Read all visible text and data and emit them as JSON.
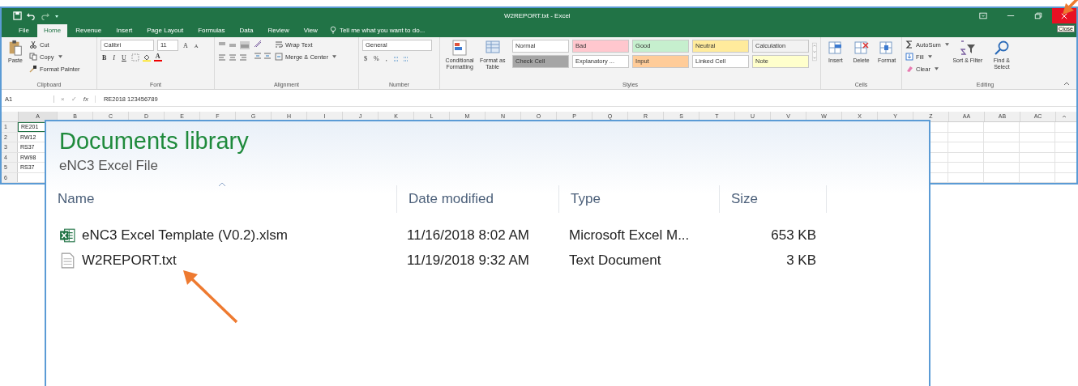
{
  "window": {
    "title": "W2REPORT.txt - Excel",
    "tooltip": "Close"
  },
  "tabs": [
    {
      "label": "File",
      "selected": false
    },
    {
      "label": "Home",
      "selected": true
    },
    {
      "label": "Revenue",
      "selected": false
    },
    {
      "label": "Insert",
      "selected": false
    },
    {
      "label": "Page Layout",
      "selected": false
    },
    {
      "label": "Formulas",
      "selected": false
    },
    {
      "label": "Data",
      "selected": false
    },
    {
      "label": "Review",
      "selected": false
    },
    {
      "label": "View",
      "selected": false
    }
  ],
  "tell_me": "Tell me what you want to do...",
  "ribbon": {
    "clipboard": {
      "label": "Clipboard",
      "paste": "Paste",
      "cut": "Cut",
      "copy": "Copy",
      "format_painter": "Format Painter"
    },
    "font": {
      "label": "Font",
      "font_name": "Calibri",
      "font_size": "11",
      "grow": "A",
      "shrink": "A",
      "bold": "B",
      "italic": "I",
      "underline": "U",
      "font_color": "A"
    },
    "alignment": {
      "label": "Alignment",
      "wrap_text": "Wrap Text",
      "merge": "Merge & Center"
    },
    "number": {
      "label": "Number",
      "format": "General",
      "currency": "$",
      "percent": "%",
      "comma": ","
    },
    "styles": {
      "label": "Styles",
      "conditional": "Conditional Formatting",
      "format_table": "Format as Table",
      "cells": [
        {
          "label": "Normal",
          "color": "#ffffff"
        },
        {
          "label": "Bad",
          "color": "#ffc7ce"
        },
        {
          "label": "Good",
          "color": "#c6efce"
        },
        {
          "label": "Neutral",
          "color": "#ffeb9c"
        },
        {
          "label": "Calculation",
          "color": "#f2f2f2"
        },
        {
          "label": "Check Cell",
          "color": "#a5a5a5"
        },
        {
          "label": "Explanatory ...",
          "color": "#ffffff"
        },
        {
          "label": "Input",
          "color": "#ffcc99"
        },
        {
          "label": "Linked Cell",
          "color": "#ffffff"
        },
        {
          "label": "Note",
          "color": "#ffffcc"
        }
      ]
    },
    "cells": {
      "label": "Cells",
      "buttons": [
        "Insert",
        "Delete",
        "Format"
      ]
    },
    "editing": {
      "label": "Editing",
      "autosum": "AutoSum",
      "fill": "Fill",
      "clear": "Clear",
      "sort": "Sort & Filter",
      "find": "Find & Select"
    }
  },
  "formula_bar": {
    "name_box": "A1",
    "cancel": "×",
    "enter": "✓",
    "fx": "fx",
    "formula": "RE2018 123456789"
  },
  "sheet": {
    "columns": [
      "A",
      "B",
      "C",
      "D",
      "E",
      "F",
      "G",
      "H",
      "I",
      "J",
      "K",
      "L",
      "M",
      "N",
      "O",
      "P",
      "Q",
      "R",
      "S",
      "T",
      "U",
      "V",
      "W",
      "X",
      "Y",
      "Z",
      "AA",
      "AB",
      "AC"
    ],
    "rows": [
      {
        "number": "1",
        "a": "RE201"
      },
      {
        "number": "2",
        "a": "RW12"
      },
      {
        "number": "3",
        "a": "RS37"
      },
      {
        "number": "4",
        "a": "RW98"
      },
      {
        "number": "5",
        "a": "RS37"
      },
      {
        "number": "6"
      }
    ]
  },
  "explorer": {
    "title": "Documents library",
    "subtitle": "eNC3 Excel File",
    "columns": [
      "Name",
      "Date modified",
      "Type",
      "Size"
    ],
    "files": [
      {
        "kind": "excel",
        "name": "eNC3 Excel Template (V0.2).xlsm",
        "date": "11/16/2018 8:02 AM",
        "type": "Microsoft Excel M...",
        "size": "653 KB"
      },
      {
        "kind": "text",
        "name": "W2REPORT.txt",
        "date": "11/19/2018 9:32 AM",
        "type": "Text Document",
        "size": "3 KB"
      }
    ]
  }
}
